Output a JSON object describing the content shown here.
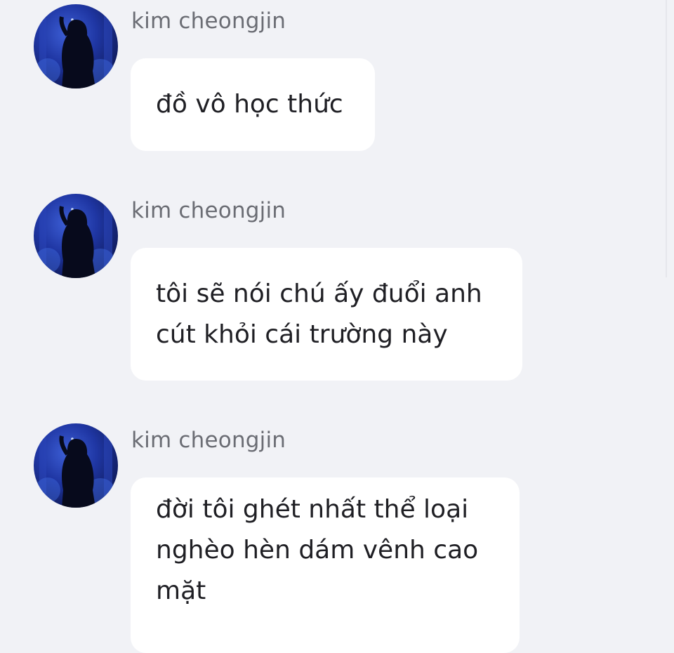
{
  "messages": [
    {
      "sender": "kim cheongjin",
      "text": "đồ vô học thức"
    },
    {
      "sender": "kim cheongjin",
      "text": "tôi sẽ nói chú ấy đuổi anh\ncút khỏi cái trường này"
    },
    {
      "sender": "kim cheongjin",
      "text": "đời tôi ghét nhất thể loại\nnghèo hèn dám vênh cao\nmặt"
    }
  ],
  "colors": {
    "background": "#f1f2f6",
    "bubble": "#ffffff",
    "sender_text": "#6b6d74",
    "message_text": "#1f1f24"
  },
  "icons": {
    "avatar": "profile-photo"
  }
}
